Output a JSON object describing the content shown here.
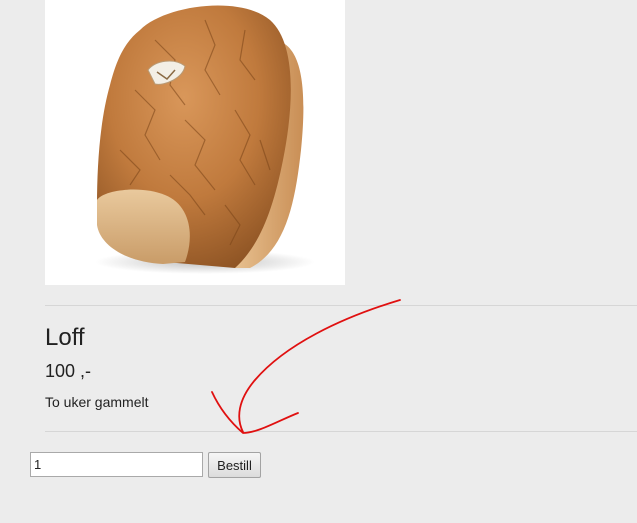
{
  "product": {
    "image_icon": "bread-loaf-photo",
    "name": "Loff",
    "price": "100 ,-",
    "description": "To uker gammelt"
  },
  "order": {
    "quantity_value": "1",
    "button_label": "Bestill"
  },
  "annotation": {
    "color": "#e01010"
  }
}
